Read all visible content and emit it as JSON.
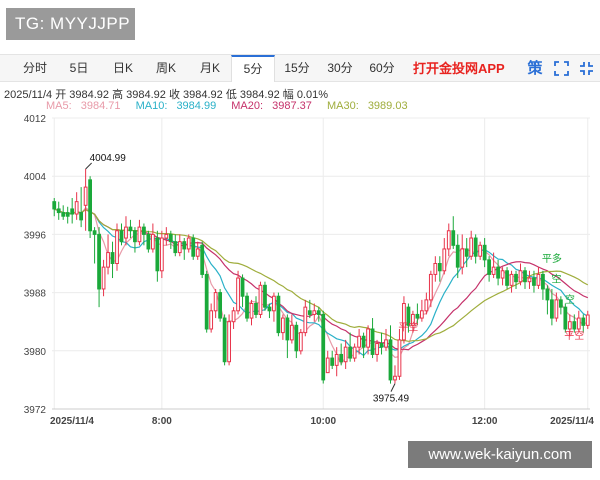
{
  "badge": {
    "text": "TG: MYYJJPP"
  },
  "tabs": [
    {
      "label": "分时",
      "active": false
    },
    {
      "label": "5日",
      "active": false
    },
    {
      "label": "日K",
      "active": false
    },
    {
      "label": "周K",
      "active": false
    },
    {
      "label": "月K",
      "active": false
    },
    {
      "label": "5分",
      "active": true
    },
    {
      "label": "15分",
      "active": false
    },
    {
      "label": "30分",
      "active": false
    },
    {
      "label": "60分",
      "active": false
    }
  ],
  "app_link": "打开金投网APP",
  "icons": {
    "settings": "settings-icon",
    "fullscreen": "fullscreen-icon",
    "exit": "exit-fullscreen-icon"
  },
  "quote": {
    "date": "2025/11/4",
    "open_label": "开",
    "open": "3984.92",
    "high_label": "高",
    "high": "3984.92",
    "close_label": "收",
    "close": "3984.92",
    "low_label": "低",
    "low": "3984.92",
    "change_label": "幅",
    "change": "0.01%"
  },
  "ma": [
    {
      "label": "MA5:",
      "value": "3984.71",
      "color": "#e89aa8"
    },
    {
      "label": "MA10:",
      "value": "3984.99",
      "color": "#2ab1c8"
    },
    {
      "label": "MA20:",
      "value": "3987.37",
      "color": "#c5316a"
    },
    {
      "label": "MA30:",
      "value": "3989.03",
      "color": "#9fad3c"
    }
  ],
  "watermark_url": "www.wek-kaiyun.com",
  "colors": {
    "up": "#e8334a",
    "down": "#1aa93a",
    "grid": "#ececec",
    "axis_text": "#444444"
  },
  "chart_data": {
    "type": "candlestick",
    "ylim": [
      3972,
      4012
    ],
    "yticks": [
      3972,
      3980,
      3988,
      3996,
      4004,
      4012
    ],
    "xticks": [
      {
        "index": 0,
        "label": "2025/11/4"
      },
      {
        "index": 24,
        "label": "8:00"
      },
      {
        "index": 60,
        "label": "10:00"
      },
      {
        "index": 96,
        "label": "12:00"
      },
      {
        "index": 119,
        "label": "2025/11/4"
      }
    ],
    "annotations": [
      {
        "index": 7,
        "price": 4004.99,
        "text": "4004.99",
        "kind": "high"
      },
      {
        "index": 76,
        "price": 3975.49,
        "text": "3975.49",
        "kind": "low"
      },
      {
        "index": 79,
        "price": 3982.8,
        "text": "平空",
        "kind": "signal"
      },
      {
        "index": 111,
        "price": 3992.2,
        "text": "平多",
        "kind": "signal"
      },
      {
        "index": 112,
        "price": 3989.4,
        "text": "空",
        "kind": "signal"
      },
      {
        "index": 115,
        "price": 3986.6,
        "text": "空",
        "kind": "signal"
      },
      {
        "index": 116,
        "price": 3981.6,
        "text": "平空",
        "kind": "signal"
      }
    ],
    "candles": [
      [
        4000.5,
        3999.5,
        4001.0,
        3998.5
      ],
      [
        3999.5,
        3999.0,
        4000.5,
        3998.0
      ],
      [
        3999.0,
        3998.5,
        4000.0,
        3998.0
      ],
      [
        3999.0,
        3998.5,
        3999.8,
        3997.5
      ],
      [
        3999.5,
        3998.8,
        4001.0,
        3997.5
      ],
      [
        3998.8,
        4000.5,
        4001.8,
        3998.0
      ],
      [
        3999.0,
        3998.0,
        4002.5,
        3997.0
      ],
      [
        4000.0,
        4002.5,
        4004.99,
        3996.5
      ],
      [
        4003.5,
        3996.5,
        4004.0,
        3995.5
      ],
      [
        3996.5,
        3996.0,
        3997.0,
        3992.0
      ],
      [
        3996.0,
        3988.5,
        3997.0,
        3986.0
      ],
      [
        3988.5,
        3991.5,
        3992.5,
        3987.5
      ],
      [
        3991.5,
        3993.5,
        3996.0,
        3990.5
      ],
      [
        3993.5,
        3992.0,
        3995.0,
        3990.0
      ],
      [
        3992.0,
        3996.5,
        3997.5,
        3991.0
      ],
      [
        3996.5,
        3995.0,
        3997.5,
        3994.5
      ],
      [
        3995.5,
        3997.0,
        3998.5,
        3994.5
      ],
      [
        3997.0,
        3996.5,
        3998.0,
        3995.5
      ],
      [
        3996.5,
        3995.0,
        3997.0,
        3993.5
      ],
      [
        3995.0,
        3997.0,
        3998.0,
        3994.5
      ],
      [
        3997.0,
        3996.0,
        3997.5,
        3994.5
      ],
      [
        3996.0,
        3994.0,
        3996.5,
        3993.5
      ],
      [
        3994.0,
        3996.0,
        3997.5,
        3993.5
      ],
      [
        3995.5,
        3991.0,
        3996.5,
        3989.5
      ],
      [
        3991.0,
        3995.5,
        3996.5,
        3990.0
      ],
      [
        3995.5,
        3996.0,
        3997.0,
        3994.5
      ],
      [
        3996.0,
        3995.0,
        3996.5,
        3994.0
      ],
      [
        3995.0,
        3993.5,
        3996.0,
        3993.0
      ],
      [
        3993.5,
        3995.0,
        3996.0,
        3993.0
      ],
      [
        3995.0,
        3994.0,
        3995.5,
        3992.5
      ],
      [
        3994.0,
        3995.5,
        3996.0,
        3993.5
      ],
      [
        3995.5,
        3993.0,
        3996.0,
        3992.5
      ],
      [
        3993.0,
        3994.0,
        3995.0,
        3992.5
      ],
      [
        3994.5,
        3990.5,
        3995.0,
        3990.0
      ],
      [
        3990.5,
        3983.0,
        3991.0,
        3982.5
      ],
      [
        3983.0,
        3985.5,
        3986.5,
        3982.5
      ],
      [
        3985.5,
        3988.0,
        3988.5,
        3984.5
      ],
      [
        3988.0,
        3984.5,
        3988.5,
        3984.0
      ],
      [
        3984.5,
        3978.5,
        3985.0,
        3978.0
      ],
      [
        3978.5,
        3984.0,
        3985.0,
        3978.0
      ],
      [
        3984.0,
        3985.5,
        3986.0,
        3983.0
      ],
      [
        3985.5,
        3990.0,
        3991.0,
        3985.0
      ],
      [
        3990.0,
        3987.5,
        3990.5,
        3986.0
      ],
      [
        3987.5,
        3984.5,
        3988.0,
        3984.0
      ],
      [
        3984.5,
        3986.5,
        3987.0,
        3983.5
      ],
      [
        3986.5,
        3985.0,
        3987.5,
        3984.5
      ],
      [
        3985.0,
        3989.0,
        3989.5,
        3984.5
      ],
      [
        3989.0,
        3986.0,
        3989.5,
        3985.5
      ],
      [
        3986.0,
        3985.5,
        3986.5,
        3984.5
      ],
      [
        3985.5,
        3987.5,
        3988.0,
        3984.0
      ],
      [
        3987.5,
        3982.5,
        3988.0,
        3982.0
      ],
      [
        3982.5,
        3984.5,
        3985.0,
        3981.5
      ],
      [
        3984.5,
        3981.5,
        3985.0,
        3979.0
      ],
      [
        3981.5,
        3983.5,
        3985.0,
        3981.0
      ],
      [
        3983.5,
        3980.0,
        3984.0,
        3979.0
      ],
      [
        3980.0,
        3982.5,
        3983.0,
        3979.5
      ],
      [
        3982.5,
        3986.0,
        3987.0,
        3982.0
      ],
      [
        3985.5,
        3985.0,
        3987.0,
        3984.5
      ],
      [
        3985.0,
        3985.5,
        3986.5,
        3984.0
      ],
      [
        3985.5,
        3985.0,
        3986.0,
        3984.0
      ],
      [
        3985.0,
        3976.0,
        3985.5,
        3975.5
      ],
      [
        3977.0,
        3979.0,
        3980.0,
        3977.0
      ],
      [
        3979.0,
        3978.0,
        3980.0,
        3977.5
      ],
      [
        3978.0,
        3979.5,
        3980.5,
        3976.5
      ],
      [
        3979.5,
        3978.5,
        3981.0,
        3978.0
      ],
      [
        3978.5,
        3980.5,
        3981.5,
        3977.5
      ],
      [
        3980.5,
        3979.0,
        3982.5,
        3978.5
      ],
      [
        3979.0,
        3980.5,
        3981.0,
        3978.5
      ],
      [
        3980.5,
        3982.0,
        3983.0,
        3979.5
      ],
      [
        3982.0,
        3980.5,
        3982.5,
        3979.0
      ],
      [
        3980.5,
        3983.0,
        3983.5,
        3979.5
      ],
      [
        3983.0,
        3979.5,
        3984.5,
        3979.0
      ],
      [
        3979.5,
        3981.0,
        3981.5,
        3978.5
      ],
      [
        3981.0,
        3980.5,
        3982.5,
        3979.5
      ],
      [
        3980.5,
        3981.5,
        3983.0,
        3980.0
      ],
      [
        3981.5,
        3976.0,
        3983.5,
        3975.49
      ],
      [
        3976.0,
        3976.5,
        3978.0,
        3975.5
      ],
      [
        3976.5,
        3981.5,
        3983.0,
        3976.0
      ],
      [
        3981.5,
        3986.5,
        3987.5,
        3981.0
      ],
      [
        3986.0,
        3983.5,
        3986.5,
        3982.5
      ],
      [
        3983.5,
        3985.0,
        3985.5,
        3982.5
      ],
      [
        3985.0,
        3984.5,
        3986.5,
        3983.5
      ],
      [
        3984.5,
        3985.5,
        3987.0,
        3984.0
      ],
      [
        3985.5,
        3987.0,
        3988.0,
        3985.0
      ],
      [
        3987.0,
        3990.5,
        3991.0,
        3986.0
      ],
      [
        3990.5,
        3992.0,
        3993.0,
        3989.5
      ],
      [
        3992.0,
        3991.0,
        3993.0,
        3989.5
      ],
      [
        3991.0,
        3994.0,
        3995.5,
        3990.5
      ],
      [
        3994.0,
        3996.5,
        3997.5,
        3993.0
      ],
      [
        3996.5,
        3994.5,
        3998.5,
        3994.0
      ],
      [
        3994.5,
        3991.5,
        3996.0,
        3990.0
      ],
      [
        3991.5,
        3994.0,
        3996.0,
        3990.5
      ],
      [
        3994.0,
        3993.0,
        3995.5,
        3991.5
      ],
      [
        3993.0,
        3995.5,
        3996.5,
        3992.5
      ],
      [
        3995.5,
        3993.0,
        3996.0,
        3992.0
      ],
      [
        3993.0,
        3994.5,
        3995.0,
        3992.5
      ],
      [
        3994.5,
        3992.5,
        3995.5,
        3991.5
      ],
      [
        3992.5,
        3990.5,
        3993.0,
        3989.5
      ],
      [
        3990.5,
        3991.5,
        3993.5,
        3990.0
      ],
      [
        3991.5,
        3990.0,
        3992.5,
        3989.0
      ],
      [
        3990.0,
        3991.0,
        3991.5,
        3989.0
      ],
      [
        3991.0,
        3989.0,
        3991.5,
        3988.5
      ],
      [
        3989.0,
        3990.5,
        3991.0,
        3988.0
      ],
      [
        3990.5,
        3989.5,
        3991.0,
        3988.5
      ],
      [
        3989.5,
        3991.0,
        3992.0,
        3989.0
      ],
      [
        3991.0,
        3989.5,
        3991.5,
        3988.5
      ],
      [
        3989.5,
        3990.0,
        3991.0,
        3988.5
      ],
      [
        3990.0,
        3989.0,
        3991.0,
        3988.0
      ],
      [
        3989.0,
        3990.5,
        3991.5,
        3988.5
      ],
      [
        3990.5,
        3988.5,
        3991.0,
        3987.0
      ],
      [
        3988.5,
        3987.0,
        3989.0,
        3985.0
      ],
      [
        3987.0,
        3984.5,
        3988.5,
        3983.5
      ],
      [
        3984.5,
        3987.0,
        3988.0,
        3984.0
      ],
      [
        3987.0,
        3986.0,
        3987.5,
        3985.0
      ],
      [
        3986.0,
        3983.0,
        3986.5,
        3982.5
      ],
      [
        3983.0,
        3984.0,
        3985.0,
        3982.0
      ],
      [
        3984.0,
        3983.0,
        3985.0,
        3982.5
      ],
      [
        3983.0,
        3984.5,
        3985.5,
        3982.5
      ],
      [
        3984.5,
        3983.5,
        3985.0,
        3982.5
      ],
      [
        3983.5,
        3984.92,
        3985.5,
        3983.0
      ]
    ]
  }
}
